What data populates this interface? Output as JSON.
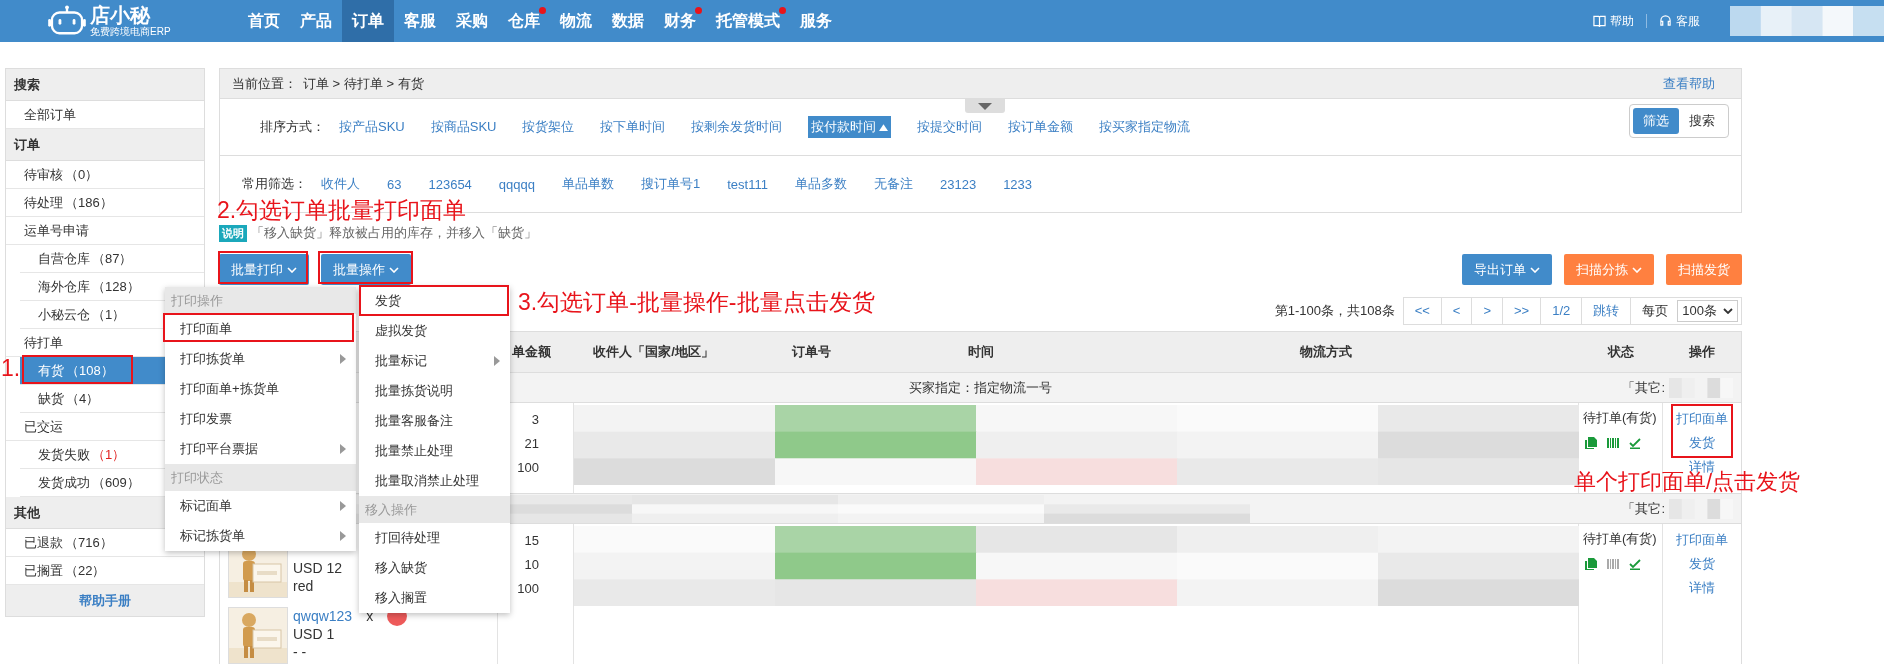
{
  "top_nav": {
    "logo": {
      "name": "店小秘",
      "tagline": "免费跨境电商ERP"
    },
    "items": [
      {
        "label": "首页",
        "selected": false,
        "dot": false
      },
      {
        "label": "产品",
        "selected": false,
        "dot": false
      },
      {
        "label": "订单",
        "selected": true,
        "dot": false
      },
      {
        "label": "客服",
        "selected": false,
        "dot": false
      },
      {
        "label": "采购",
        "selected": false,
        "dot": false
      },
      {
        "label": "仓库",
        "selected": false,
        "dot": true
      },
      {
        "label": "物流",
        "selected": false,
        "dot": false
      },
      {
        "label": "数据",
        "selected": false,
        "dot": false
      },
      {
        "label": "财务",
        "selected": false,
        "dot": true
      },
      {
        "label": "托管模式",
        "selected": false,
        "dot": true
      },
      {
        "label": "服务",
        "selected": false,
        "dot": false
      }
    ],
    "help": "帮助",
    "service": "客服"
  },
  "sidebar": {
    "sections": [
      {
        "title": "搜索",
        "items": [
          {
            "label": "全部订单",
            "selected": false
          }
        ]
      },
      {
        "title": "订单",
        "items": [
          {
            "label": "待审核",
            "count": "（0）",
            "selected": false,
            "alert": false
          },
          {
            "label": "待处理",
            "count": "（186）",
            "selected": false,
            "alert": false
          },
          {
            "label": "运单号申请",
            "selected": false,
            "children": [
              {
                "label": "自营仓库",
                "count": "（87）",
                "selected": false,
                "alert": false
              },
              {
                "label": "海外仓库",
                "count": "（128）",
                "selected": false,
                "alert": false
              },
              {
                "label": "小秘云仓",
                "count": "（1）",
                "selected": false,
                "alert": false
              }
            ]
          },
          {
            "label": "待打单",
            "selected": false,
            "children": [
              {
                "label": "有货",
                "count": "（108）",
                "selected": true,
                "alert": false
              },
              {
                "label": "缺货",
                "count": "（4）",
                "selected": false,
                "alert": false
              }
            ]
          },
          {
            "label": "已交运",
            "selected": false,
            "children": [
              {
                "label": "发货失败",
                "count": "（1）",
                "selected": false,
                "alert": true
              },
              {
                "label": "发货成功",
                "count": "（609）",
                "selected": false,
                "alert": false
              }
            ]
          }
        ]
      },
      {
        "title": "其他",
        "items": [
          {
            "label": "已退款",
            "count": "（716）",
            "selected": false,
            "alert": false
          },
          {
            "label": "已搁置",
            "count": "（22）",
            "selected": false,
            "alert": false
          }
        ]
      }
    ],
    "footer": "帮助手册"
  },
  "breadcrumb": {
    "label": "当前位置：",
    "path": "订单 > 待打单 > 有货",
    "help": "查看帮助"
  },
  "sort": {
    "label": "排序方式：",
    "options": [
      {
        "label": "按产品SKU",
        "selected": false
      },
      {
        "label": "按商品SKU",
        "selected": false
      },
      {
        "label": "按货架位",
        "selected": false
      },
      {
        "label": "按下单时间",
        "selected": false
      },
      {
        "label": "按剩余发货时间",
        "selected": false
      },
      {
        "label": "按付款时间",
        "selected": true
      },
      {
        "label": "按提交时间",
        "selected": false
      },
      {
        "label": "按订单金额",
        "selected": false
      },
      {
        "label": "按买家指定物流",
        "selected": false
      }
    ],
    "modes": [
      {
        "label": "筛选",
        "selected": true
      },
      {
        "label": "搜索",
        "selected": false
      }
    ]
  },
  "filters": {
    "label": "常用筛选：",
    "items": [
      "收件人",
      "63",
      "123654",
      "qqqqq",
      "单品单数",
      "搜订单号1",
      "test111",
      "单品多数",
      "无备注",
      "23123",
      "1233"
    ]
  },
  "notice": {
    "badge": "说明",
    "text": "「移入缺货」释放被占用的库存，并移入「缺货」"
  },
  "actions": {
    "left": [
      {
        "label": "批量打印",
        "kind": "blue",
        "dropdown": true
      },
      {
        "label": "批量操作",
        "kind": "blue",
        "dropdown": true
      }
    ],
    "right": [
      {
        "label": "导出订单",
        "kind": "blue",
        "dropdown": true
      },
      {
        "label": "扫描分拣",
        "kind": "orange",
        "dropdown": true
      },
      {
        "label": "扫描发货",
        "kind": "orange",
        "dropdown": false
      }
    ]
  },
  "pagination": {
    "summary": "第1-100条，共108条",
    "buttons": [
      "<<",
      "<",
      ">",
      ">>"
    ],
    "page": "1/2",
    "jump": "跳转",
    "per_page_label": "每页",
    "per_page": "100条"
  },
  "table": {
    "columns": [
      "单金额",
      "收件人「国家/地区」",
      "订单号",
      "时间",
      "物流方式",
      "状态",
      "操作"
    ],
    "groups": [
      {
        "label": "买家指定：指定物流一号",
        "other": "「其它:",
        "row": {
          "amounts": [
            "3",
            "21",
            "100"
          ],
          "status": "待打单(有货)",
          "icons": [
            {
              "kind": "copy",
              "active": true
            },
            {
              "kind": "barcode",
              "active": true
            },
            {
              "kind": "check",
              "active": true
            }
          ],
          "ops": [
            "打印面单",
            "发货",
            "详情"
          ]
        }
      },
      {
        "other": "「其它:",
        "row": {
          "amounts": [
            "15",
            "10",
            "100"
          ],
          "products": [
            {
              "lines": [
                "USD 12",
                "red"
              ]
            },
            {
              "sku": "qwqw123",
              "qty": "x",
              "lines": [
                "USD 1",
                "- -"
              ]
            }
          ],
          "status": "待打单(有货)",
          "icons": [
            {
              "kind": "copy",
              "active": true
            },
            {
              "kind": "barcode",
              "active": false
            },
            {
              "kind": "check",
              "active": true
            }
          ],
          "ops": [
            "打印面单",
            "发货",
            "详情"
          ]
        }
      }
    ]
  },
  "print_menu": {
    "sections": [
      {
        "title": "打印操作",
        "items": [
          {
            "label": "打印面单",
            "submenu": false
          },
          {
            "label": "打印拣货单",
            "submenu": true
          },
          {
            "label": "打印面单+拣货单",
            "submenu": false
          },
          {
            "label": "打印发票",
            "submenu": false
          },
          {
            "label": "打印平台票据",
            "submenu": true
          }
        ]
      },
      {
        "title": "打印状态",
        "items": [
          {
            "label": "标记面单",
            "submenu": true
          },
          {
            "label": "标记拣货单",
            "submenu": true
          }
        ]
      }
    ]
  },
  "batch_menu": {
    "sections": [
      {
        "items": [
          {
            "label": "发货",
            "submenu": false
          },
          {
            "label": "虚拟发货",
            "submenu": false
          },
          {
            "label": "批量标记",
            "submenu": true
          },
          {
            "label": "批量拣货说明",
            "submenu": false
          },
          {
            "label": "批量客服备注",
            "submenu": false
          },
          {
            "label": "批量禁止处理",
            "submenu": false
          },
          {
            "label": "批量取消禁止处理",
            "submenu": false
          }
        ]
      },
      {
        "title": "移入操作",
        "items": [
          {
            "label": "打回待处理",
            "submenu": false
          },
          {
            "label": "移入缺货",
            "submenu": false
          },
          {
            "label": "移入搁置",
            "submenu": false
          }
        ]
      }
    ]
  },
  "annotations": [
    {
      "text": "1."
    },
    {
      "text": "2.勾选订单批量打印面单"
    },
    {
      "text": "3.勾选订单-批量操作-批量点击发货"
    },
    {
      "text": "单个打印面单/点击发货"
    }
  ]
}
